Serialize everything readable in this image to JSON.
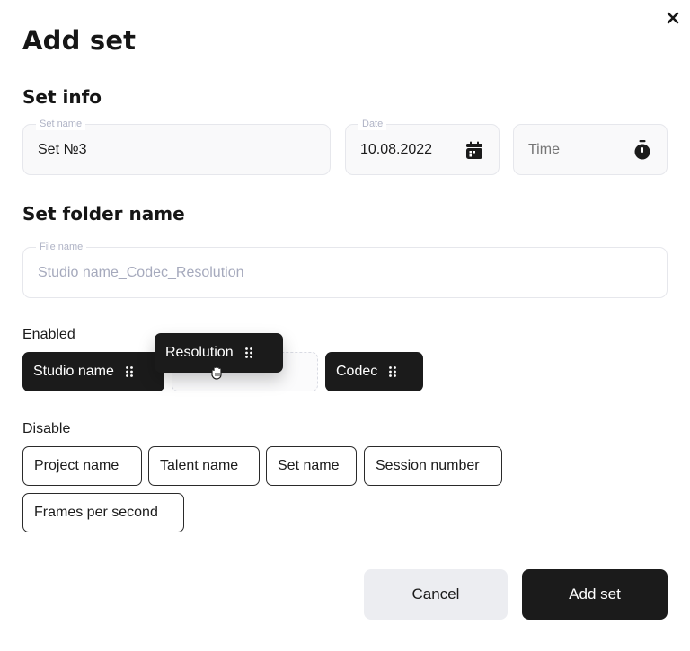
{
  "dialog": {
    "title": "Add set",
    "close_icon": "close-icon"
  },
  "set_info": {
    "heading": "Set info",
    "set_name": {
      "label": "Set name",
      "value": "Set №3"
    },
    "date": {
      "label": "Date",
      "value": "10.08.2022",
      "icon": "calendar-icon"
    },
    "time": {
      "label": "",
      "placeholder": "Time",
      "value": "",
      "icon": "stopwatch-icon"
    }
  },
  "folder": {
    "heading": "Set folder name",
    "file_name": {
      "label": "File name",
      "value": "Studio name_Codec_Resolution"
    }
  },
  "enabled": {
    "label": "Enabled",
    "chips": [
      {
        "label": "Studio name"
      },
      {
        "label": "Resolution",
        "state": "dragging"
      },
      {
        "label": "Codec"
      }
    ]
  },
  "disabled": {
    "label": "Disable",
    "chips": [
      {
        "label": "Project name"
      },
      {
        "label": "Talent name"
      },
      {
        "label": "Set name"
      },
      {
        "label": "Session number"
      },
      {
        "label": "Frames per second"
      }
    ]
  },
  "actions": {
    "cancel_label": "Cancel",
    "submit_label": "Add set"
  },
  "colors": {
    "primary": "#1b1b1b",
    "secondary_button": "#ecedf1",
    "field_background": "#f9f9fa",
    "muted_text": "#a6aabd"
  }
}
